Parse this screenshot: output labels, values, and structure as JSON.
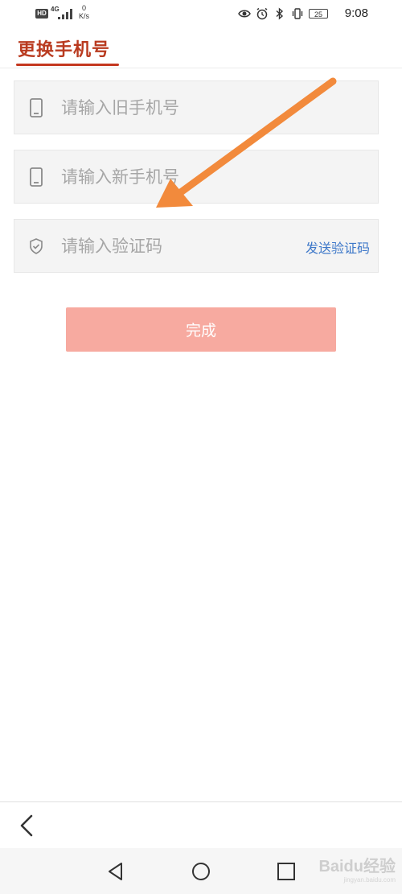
{
  "status_bar": {
    "hd": "HD",
    "network": "4G",
    "speed_value": "0",
    "speed_unit": "K/s",
    "battery": "25",
    "time": "9:08",
    "icons": [
      "eye-icon",
      "alarm-icon",
      "bluetooth-icon",
      "vibrate-icon",
      "battery-icon"
    ]
  },
  "header": {
    "title": "更换手机号"
  },
  "form": {
    "old_phone": {
      "placeholder": "请输入旧手机号",
      "icon": "phone-icon"
    },
    "new_phone": {
      "placeholder": "请输入新手机号",
      "icon": "phone-icon"
    },
    "code": {
      "placeholder": "请输入验证码",
      "icon": "shield-check-icon",
      "send_label": "发送验证码"
    },
    "done_label": "完成"
  },
  "colors": {
    "title": "#b93a1f",
    "accent_link": "#3e78c9",
    "button_disabled": "#f7aaa0",
    "annotation_arrow": "#f28a3c"
  },
  "watermark": {
    "text": "Baidu经验",
    "sub": "jingyan.baidu.com"
  }
}
